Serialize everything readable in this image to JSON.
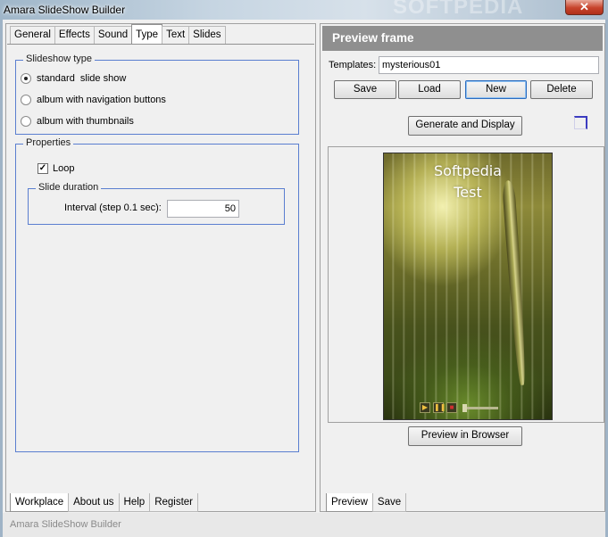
{
  "window": {
    "title": "Amara SlideShow Builder",
    "watermark": "SOFTPEDIA",
    "close_glyph": "✕"
  },
  "left_tabs": [
    "General",
    "Effects",
    "Sound",
    "Type",
    "Text",
    "Slides"
  ],
  "active_left_tab": "Type",
  "slideshow_type": {
    "legend": "Slideshow type",
    "options": [
      {
        "label": "standard  slide show",
        "selected": true
      },
      {
        "label": "album with navigation buttons",
        "selected": false
      },
      {
        "label": "album with thumbnails",
        "selected": false
      }
    ]
  },
  "properties": {
    "legend": "Properties",
    "loop_label": "Loop",
    "loop_checked": true,
    "check_glyph": "✓",
    "slide_duration": {
      "legend": "Slide duration",
      "interval_label": "Interval (step 0.1 sec):",
      "interval_value": "50"
    }
  },
  "bottom_left_tabs": [
    "Workplace",
    "About us",
    "Help",
    "Register"
  ],
  "active_bottom_left_tab": "Workplace",
  "preview": {
    "header": "Preview frame",
    "templates_label": "Templates:",
    "templates_value": "mysterious01",
    "buttons": {
      "save": "Save",
      "load": "Load",
      "new": "New",
      "delete": "Delete"
    },
    "generate_label": "Generate and Display",
    "slide_caption": [
      "Softpedia",
      "Test"
    ],
    "preview_browser_label": "Preview in Browser",
    "controls": {
      "play": "▶",
      "pause": "❚❚",
      "stop": "■"
    }
  },
  "bottom_right_tabs": [
    "Preview",
    "Save"
  ],
  "active_bottom_right_tab": "Preview",
  "status_text": "Amara SlideShow Builder"
}
